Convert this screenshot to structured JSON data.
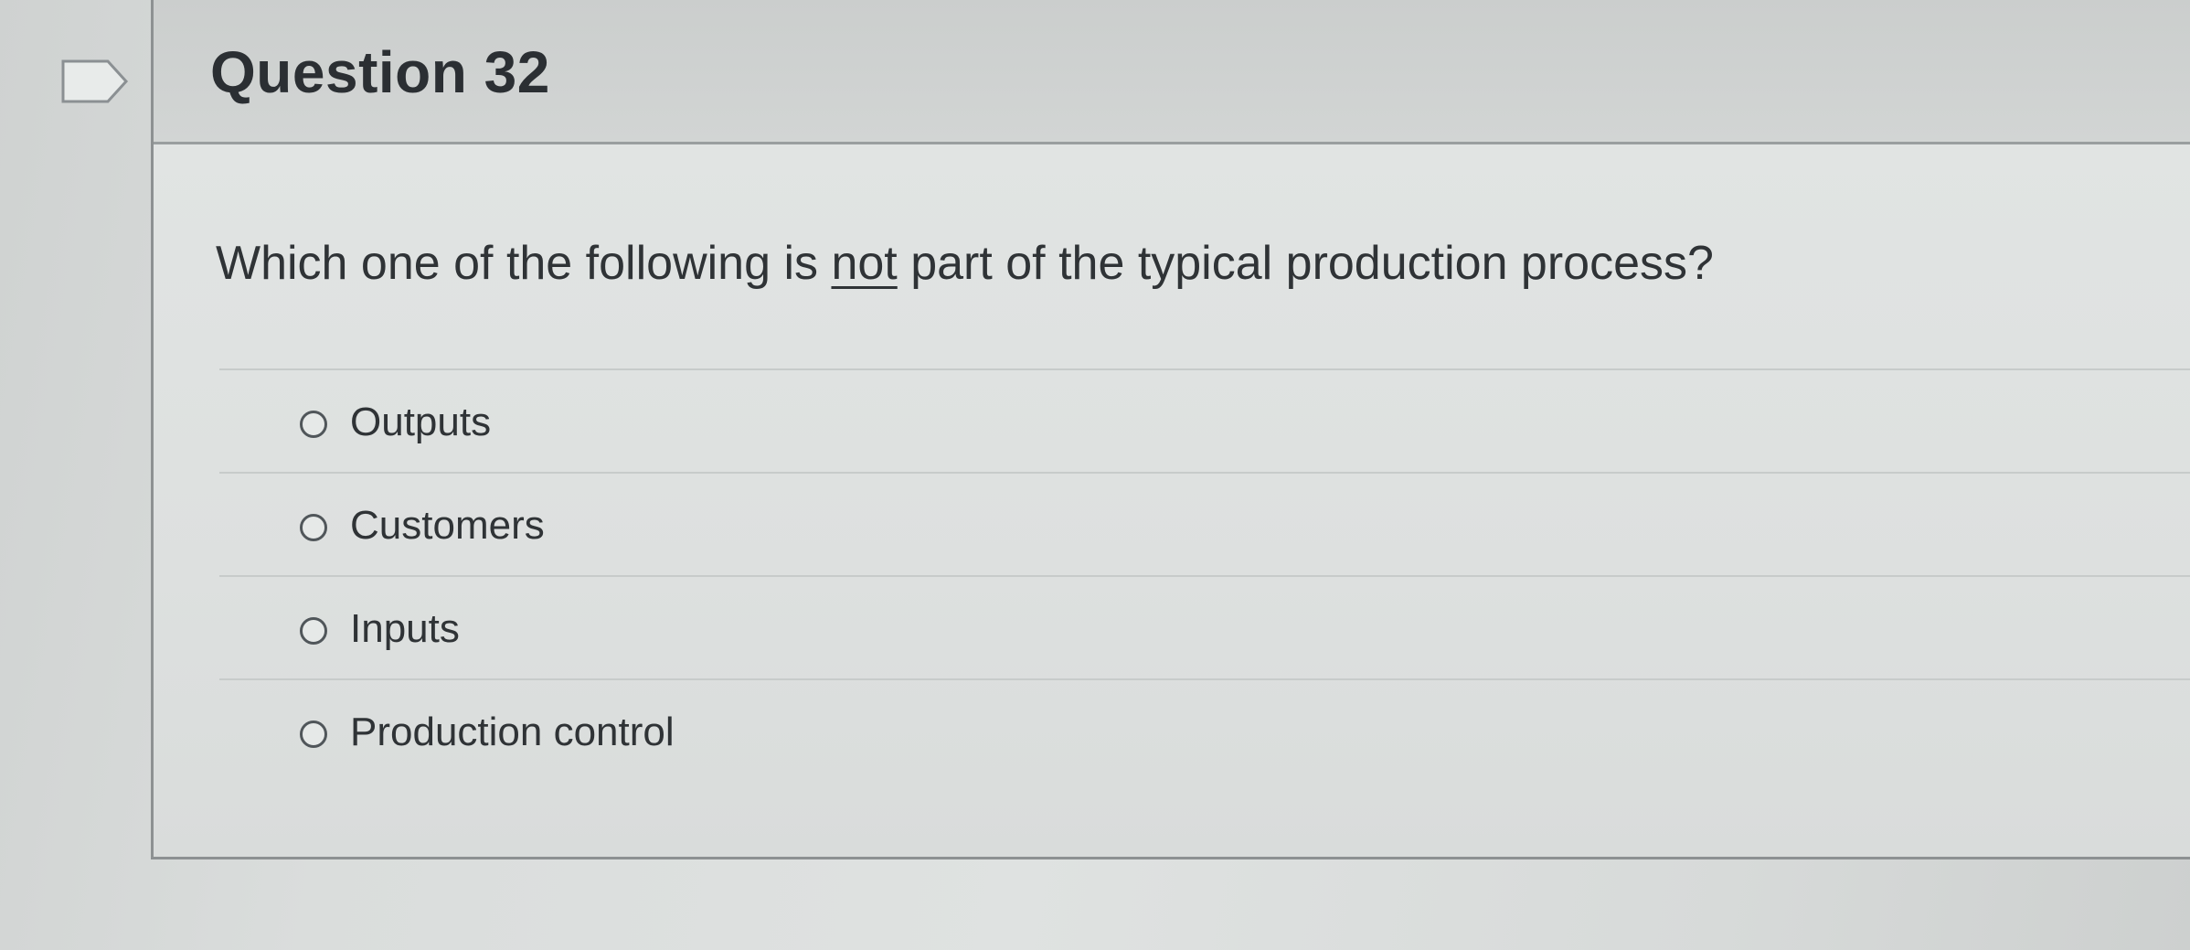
{
  "question": {
    "title": "Question 32",
    "text_before": "Which one of the following is ",
    "text_emphasis": "not",
    "text_after": " part of the typical production process?",
    "answers": [
      {
        "label": "Outputs"
      },
      {
        "label": "Customers"
      },
      {
        "label": "Inputs"
      },
      {
        "label": "Production control"
      }
    ]
  },
  "icons": {
    "flag": "flag-icon"
  },
  "colors": {
    "text": "#2f3336",
    "header_background": "#cbcecd",
    "body_background": "#e1e4e3",
    "border": "#8d9192"
  }
}
